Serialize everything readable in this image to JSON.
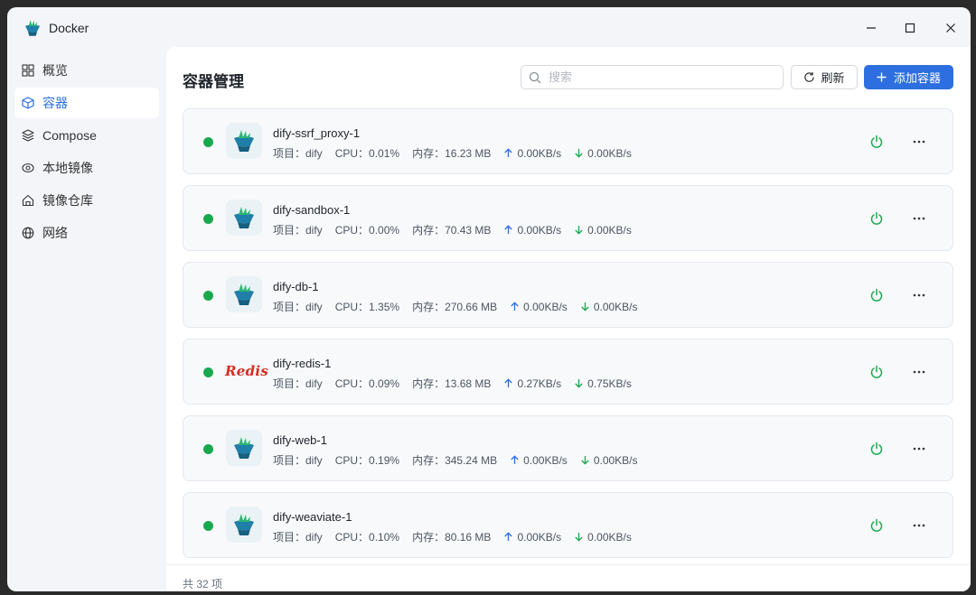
{
  "window": {
    "title": "Docker"
  },
  "sidebar": {
    "items": [
      {
        "label": "概览",
        "icon": "grid-icon",
        "active": false
      },
      {
        "label": "容器",
        "icon": "cube-icon",
        "active": true
      },
      {
        "label": "Compose",
        "icon": "layers-icon",
        "active": false
      },
      {
        "label": "本地镜像",
        "icon": "eye-icon",
        "active": false
      },
      {
        "label": "镜像仓库",
        "icon": "home-icon",
        "active": false
      },
      {
        "label": "网络",
        "icon": "globe-icon",
        "active": false
      }
    ]
  },
  "header": {
    "title": "容器管理",
    "search_placeholder": "搜索",
    "refresh_label": "刷新",
    "add_label": "添加容器"
  },
  "colors": {
    "accent": "#2d6fe0",
    "running": "#1aa84f",
    "power": "#1aa84f",
    "upload": "#2d6fe0",
    "download": "#1aa84f",
    "redis": "#d82c20"
  },
  "containers": [
    {
      "name": "dify-ssrf_proxy-1",
      "project": "项目：dify",
      "cpu": "CPU：0.01%",
      "memory": "内存：16.23 MB",
      "up": "0.00KB/s",
      "down": "0.00KB/s",
      "icon": "docker-icon"
    },
    {
      "name": "dify-sandbox-1",
      "project": "项目：dify",
      "cpu": "CPU：0.00%",
      "memory": "内存：70.43 MB",
      "up": "0.00KB/s",
      "down": "0.00KB/s",
      "icon": "docker-icon"
    },
    {
      "name": "dify-db-1",
      "project": "项目：dify",
      "cpu": "CPU：1.35%",
      "memory": "内存：270.66 MB",
      "up": "0.00KB/s",
      "down": "0.00KB/s",
      "icon": "docker-icon"
    },
    {
      "name": "dify-redis-1",
      "project": "项目：dify",
      "cpu": "CPU：0.09%",
      "memory": "内存：13.68 MB",
      "up": "0.27KB/s",
      "down": "0.75KB/s",
      "icon": "redis-logo",
      "logo_text": "Redis"
    },
    {
      "name": "dify-web-1",
      "project": "项目：dify",
      "cpu": "CPU：0.19%",
      "memory": "内存：345.24 MB",
      "up": "0.00KB/s",
      "down": "0.00KB/s",
      "icon": "docker-icon"
    },
    {
      "name": "dify-weaviate-1",
      "project": "项目：dify",
      "cpu": "CPU：0.10%",
      "memory": "内存：80.16 MB",
      "up": "0.00KB/s",
      "down": "0.00KB/s",
      "icon": "docker-icon"
    }
  ],
  "footer": {
    "total": "共 32 项"
  }
}
